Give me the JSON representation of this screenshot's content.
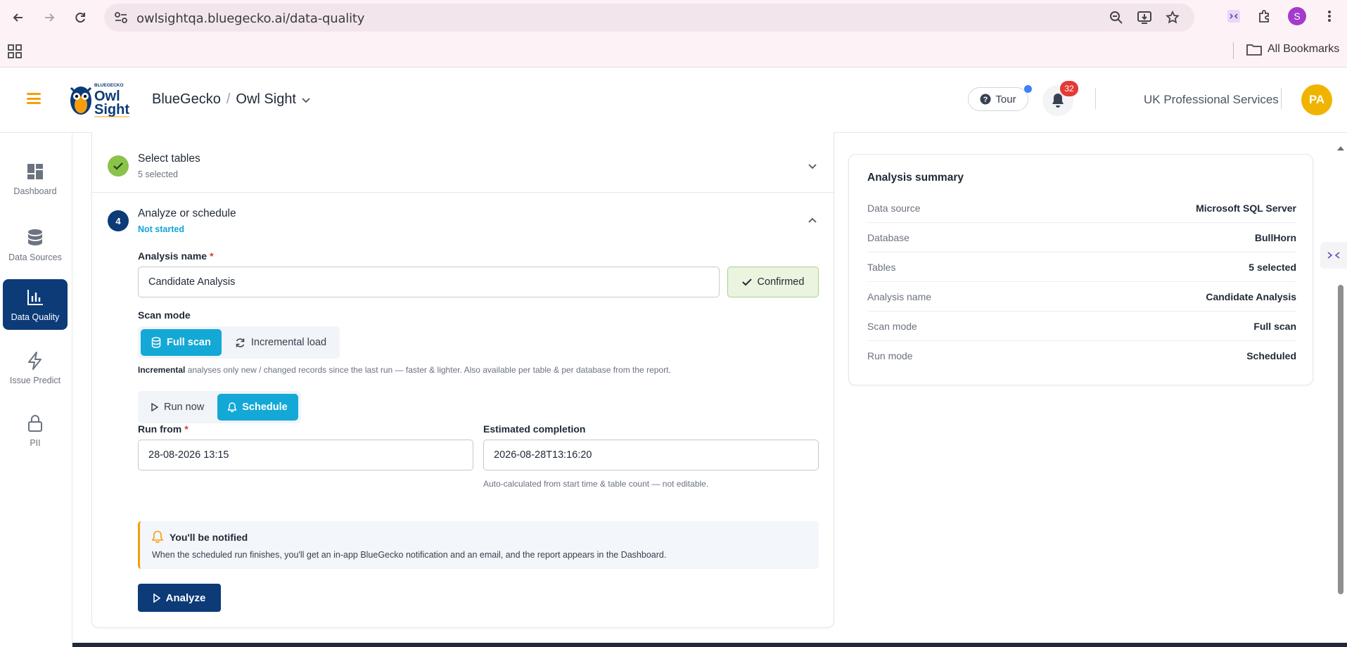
{
  "browser": {
    "url": "owlsightqa.bluegecko.ai/data-quality",
    "profile_initial": "S",
    "bookmarks_label": "All Bookmarks"
  },
  "header": {
    "logo_text_top": "BLUEGECKO",
    "logo_text_main_1": "Owl",
    "logo_text_main_2": "Sight",
    "org": "BlueGecko",
    "separator": "/",
    "product": "Owl Sight",
    "tour_label": "Tour",
    "notification_count": "32",
    "company": "UK Professional Services",
    "user_initials": "PA",
    "colors": {
      "accent": "#f59e0b",
      "primary": "#0c3b78",
      "avatar": "#f0b400"
    }
  },
  "sidebar": {
    "items": [
      {
        "label": "Dashboard",
        "icon": "dashboard-icon"
      },
      {
        "label": "Data Sources",
        "icon": "database-icon"
      },
      {
        "label": "Data Quality",
        "icon": "bar-chart-icon",
        "active": true
      },
      {
        "label": "Issue Predict",
        "icon": "lightning-icon"
      },
      {
        "label": "PII",
        "icon": "lock-icon"
      }
    ]
  },
  "steps": {
    "select_tables": {
      "title": "Select tables",
      "subtitle": "5 selected"
    },
    "analyze": {
      "number": "4",
      "title": "Analyze or schedule",
      "status": "Not started",
      "analysis_name_label": "Analysis name",
      "required_mark": "*",
      "analysis_name_value": "Candidate Analysis",
      "confirmed_label": "Confirmed",
      "scan_mode_label": "Scan mode",
      "scan_modes": [
        "Full scan",
        "Incremental load"
      ],
      "scan_mode_selected": "Full scan",
      "incremental_hint_bold": "Incremental",
      "incremental_hint": "analyses only new / changed records since the last run — faster & lighter. Also available per table & per database from the report.",
      "run_modes": [
        "Run now",
        "Schedule"
      ],
      "run_mode_selected": "Schedule",
      "run_from_label": "Run from",
      "run_from_value": "28-08-2026 13:15",
      "estimated_label": "Estimated completion",
      "estimated_value": "2026-08-28T13:16:20",
      "estimated_hint": "Auto-calculated from start time & table count — not editable.",
      "notice_title": "You'll be notified",
      "notice_text": "When the scheduled run finishes, you'll get an in-app BlueGecko notification and an email, and the report appears in the Dashboard.",
      "analyze_button": "Analyze"
    }
  },
  "summary": {
    "title": "Analysis summary",
    "rows": [
      {
        "key": "Data source",
        "value": "Microsoft SQL Server"
      },
      {
        "key": "Database",
        "value": "BullHorn"
      },
      {
        "key": "Tables",
        "value": "5 selected"
      },
      {
        "key": "Analysis name",
        "value": "Candidate Analysis"
      },
      {
        "key": "Scan mode",
        "value": "Full scan"
      },
      {
        "key": "Run mode",
        "value": "Scheduled"
      }
    ]
  }
}
